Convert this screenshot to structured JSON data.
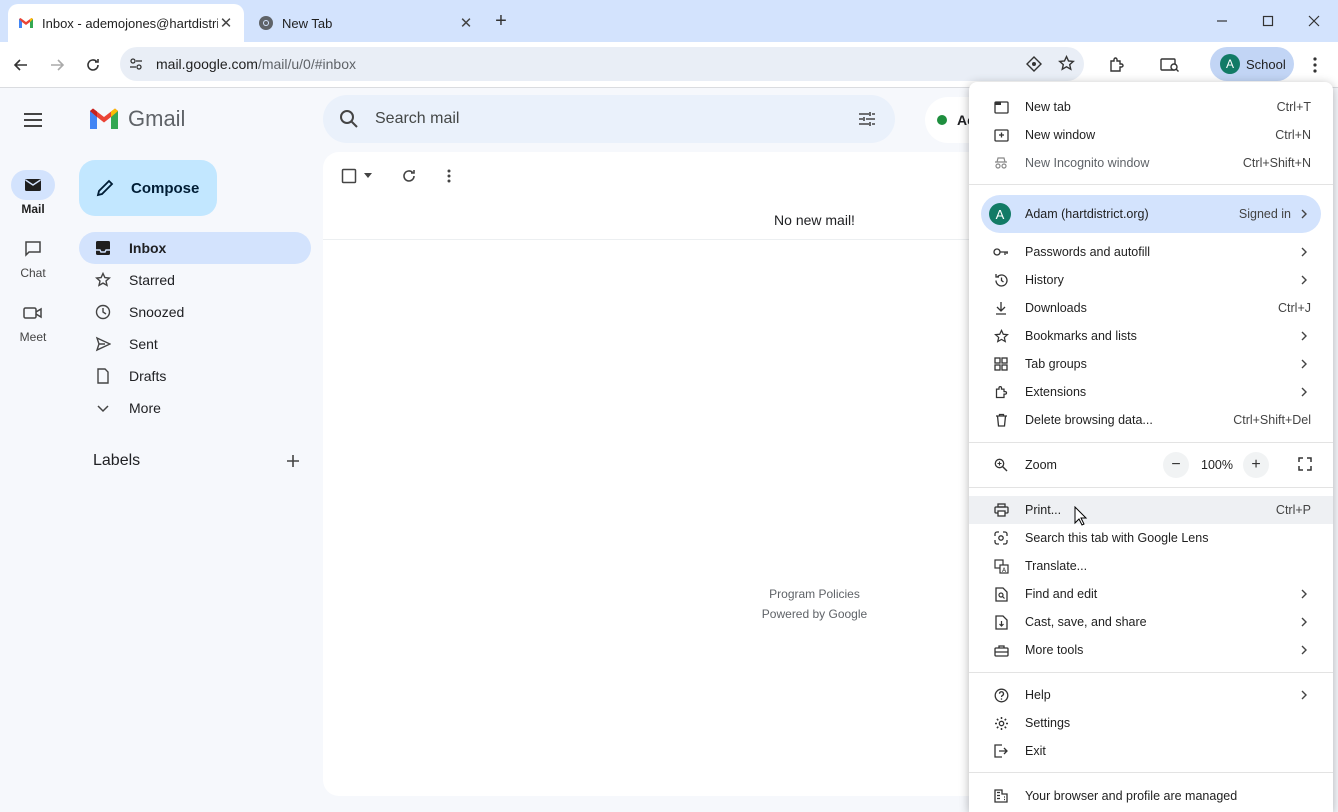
{
  "browser": {
    "tabs": [
      {
        "title": "Inbox - ademojones@hartdistri",
        "icon": "gmail-icon"
      },
      {
        "title": "New Tab",
        "icon": "chrome-icon"
      }
    ],
    "url_host": "mail.google.com",
    "url_path": "/mail/u/0/#inbox",
    "profile_initial": "A",
    "profile_label": "School"
  },
  "gmail": {
    "app_name": "Gmail",
    "rail": [
      {
        "label": "Mail",
        "icon": "mail-icon"
      },
      {
        "label": "Chat",
        "icon": "chat-icon"
      },
      {
        "label": "Meet",
        "icon": "video-icon"
      }
    ],
    "compose_label": "Compose",
    "nav": [
      {
        "label": "Inbox",
        "icon": "inbox-icon",
        "selected": true
      },
      {
        "label": "Starred",
        "icon": "star-icon"
      },
      {
        "label": "Snoozed",
        "icon": "clock-icon"
      },
      {
        "label": "Sent",
        "icon": "send-icon"
      },
      {
        "label": "Drafts",
        "icon": "draft-icon"
      },
      {
        "label": "More",
        "icon": "chevron-down-icon"
      }
    ],
    "labels_heading": "Labels",
    "search_placeholder": "Search mail",
    "status_text": "Ac",
    "empty_message": "No new mail!",
    "footer": {
      "policies": "Program Policies",
      "powered": "Powered by Google"
    }
  },
  "menu": {
    "group1": [
      {
        "label": "New tab",
        "shortcut": "Ctrl+T"
      },
      {
        "label": "New window",
        "shortcut": "Ctrl+N"
      },
      {
        "label": "New Incognito window",
        "shortcut": "Ctrl+Shift+N"
      }
    ],
    "account": {
      "initial": "A",
      "name": "Adam (hartdistrict.org)",
      "status": "Signed in"
    },
    "group2": [
      {
        "label": "Passwords and autofill",
        "shortcut": ""
      },
      {
        "label": "History",
        "shortcut": ""
      },
      {
        "label": "Downloads",
        "shortcut": "Ctrl+J"
      },
      {
        "label": "Bookmarks and lists",
        "shortcut": ""
      },
      {
        "label": "Tab groups",
        "shortcut": ""
      },
      {
        "label": "Extensions",
        "shortcut": ""
      },
      {
        "label": "Delete browsing data...",
        "shortcut": "Ctrl+Shift+Del"
      }
    ],
    "zoom": {
      "label": "Zoom",
      "value": "100%",
      "minus": "−",
      "plus": "+"
    },
    "group3": [
      {
        "label": "Print...",
        "shortcut": "Ctrl+P"
      },
      {
        "label": "Search this tab with Google Lens",
        "shortcut": ""
      },
      {
        "label": "Translate...",
        "shortcut": ""
      },
      {
        "label": "Find and edit",
        "shortcut": ""
      },
      {
        "label": "Cast, save, and share",
        "shortcut": ""
      },
      {
        "label": "More tools",
        "shortcut": ""
      }
    ],
    "group4": [
      {
        "label": "Help",
        "shortcut": ""
      },
      {
        "label": "Settings",
        "shortcut": ""
      },
      {
        "label": "Exit",
        "shortcut": ""
      }
    ],
    "managed": "Your browser and profile are managed"
  }
}
